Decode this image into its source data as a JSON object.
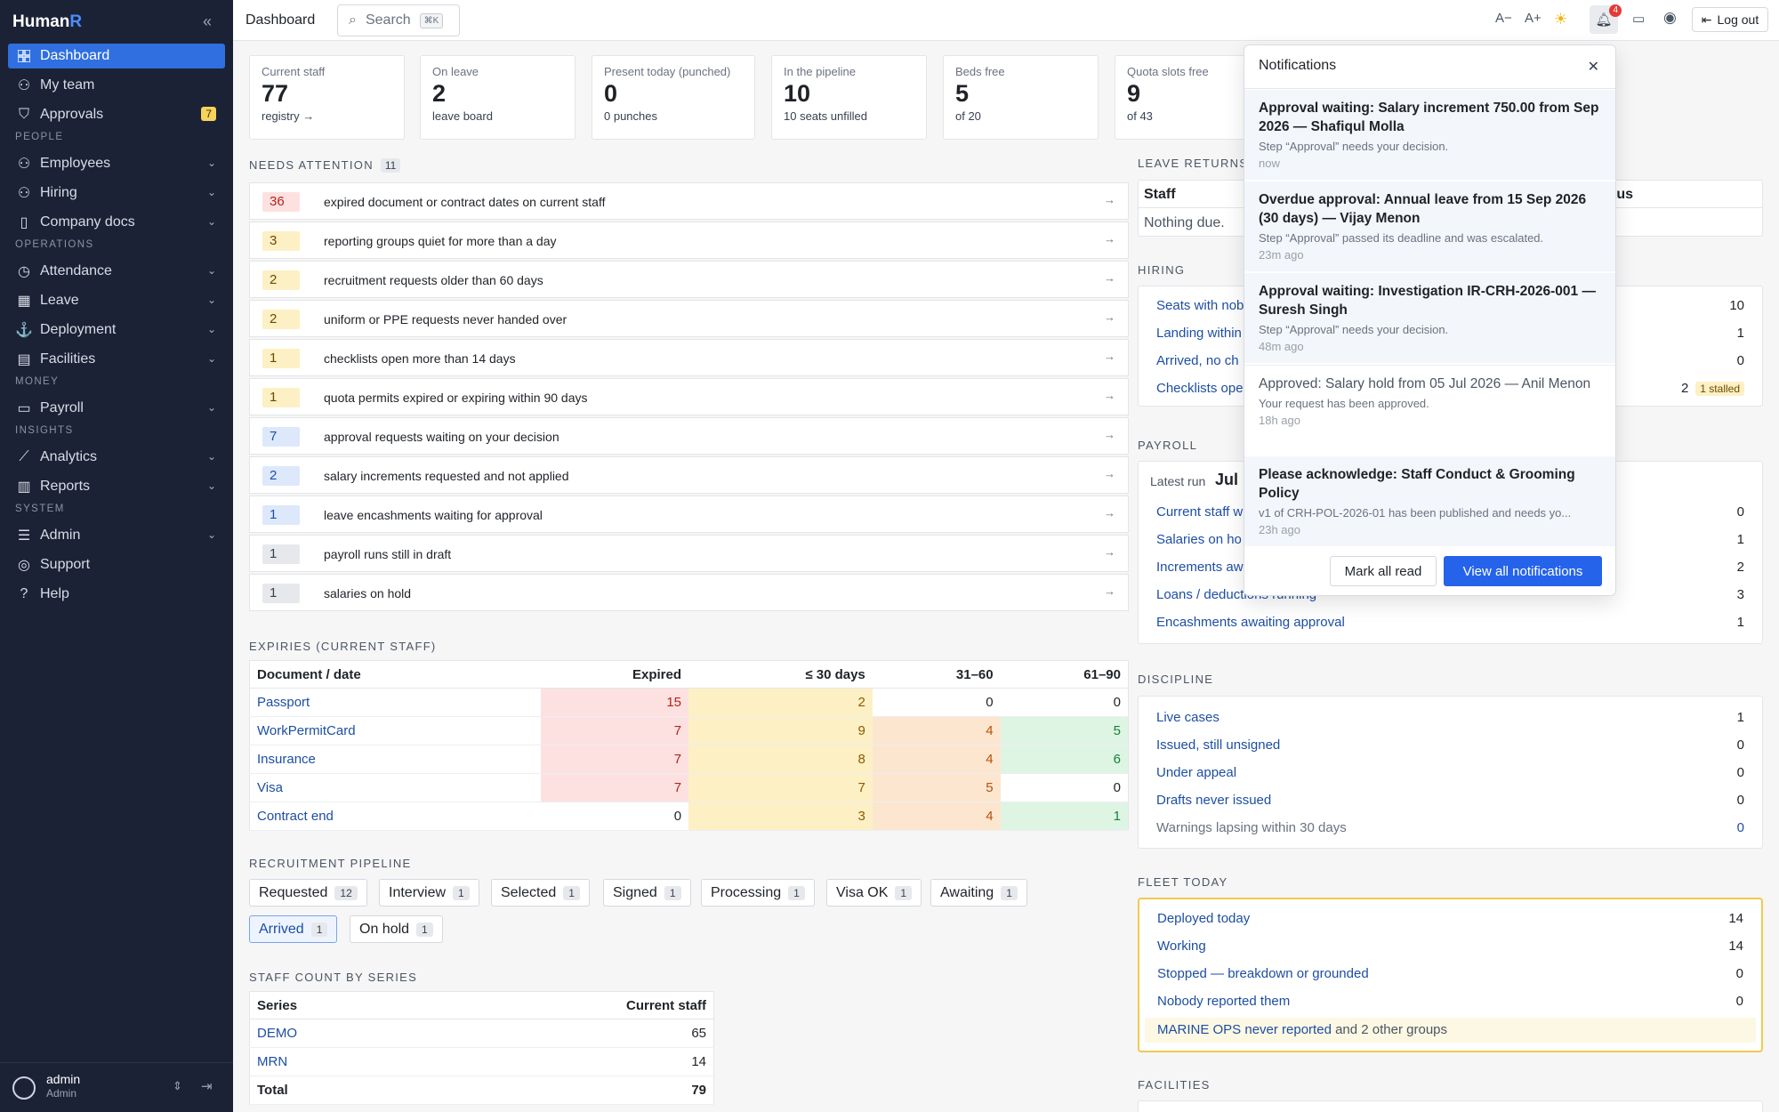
{
  "app": {
    "brand_main": "Human",
    "brand_accent": "R",
    "page_title": "Dashboard"
  },
  "search": {
    "label": "Search",
    "shortcut": "⌘K"
  },
  "topbar": {
    "font_smaller": "A−",
    "font_larger": "A+",
    "notification_count": "4",
    "logout": "Log out"
  },
  "sidebar": {
    "items": [
      {
        "label": "Dashboard"
      },
      {
        "label": "My team"
      },
      {
        "label": "Approvals",
        "badge": "7"
      },
      {
        "label": "Employees"
      },
      {
        "label": "Hiring"
      },
      {
        "label": "Company docs"
      },
      {
        "label": "Attendance"
      },
      {
        "label": "Leave"
      },
      {
        "label": "Deployment"
      },
      {
        "label": "Facilities"
      },
      {
        "label": "Payroll"
      },
      {
        "label": "Analytics"
      },
      {
        "label": "Reports"
      },
      {
        "label": "Admin"
      },
      {
        "label": "Support"
      },
      {
        "label": "Help"
      }
    ],
    "sections": [
      "PEOPLE",
      "OPERATIONS",
      "MONEY",
      "INSIGHTS",
      "SYSTEM"
    ],
    "user": {
      "name": "admin",
      "role": "Admin"
    }
  },
  "stats": [
    {
      "label": "Current staff",
      "value": "77",
      "sub": "registry →"
    },
    {
      "label": "On leave",
      "value": "2",
      "sub": "leave board"
    },
    {
      "label": "Present today (punched)",
      "value": "0",
      "sub": "0 punches"
    },
    {
      "label": "In the pipeline",
      "value": "10",
      "sub": "10 seats unfilled"
    },
    {
      "label": "Beds free",
      "value": "5",
      "sub": "of 20"
    },
    {
      "label": "Quota slots free",
      "value": "9",
      "sub": "of 43"
    }
  ],
  "attention": {
    "title": "NEEDS ATTENTION",
    "count": "11",
    "items": [
      {
        "n": "36",
        "text": "expired document or contract dates on current staff"
      },
      {
        "n": "3",
        "text": "reporting groups quiet for more than a day"
      },
      {
        "n": "2",
        "text": "recruitment requests older than 60 days"
      },
      {
        "n": "2",
        "text": "uniform or PPE requests never handed over"
      },
      {
        "n": "1",
        "text": "checklists open more than 14 days"
      },
      {
        "n": "1",
        "text": "quota permits expired or expiring within 90 days"
      },
      {
        "n": "7",
        "text": "approval requests waiting on your decision"
      },
      {
        "n": "2",
        "text": "salary increments requested and not applied"
      },
      {
        "n": "1",
        "text": "leave encashments waiting for approval"
      },
      {
        "n": "1",
        "text": "payroll runs still in draft"
      },
      {
        "n": "1",
        "text": "salaries on hold"
      }
    ]
  },
  "expiries": {
    "title": "EXPIRIES (CURRENT STAFF)",
    "headers": [
      "Document / date",
      "Expired",
      "≤ 30 days",
      "31–60",
      "61–90"
    ],
    "rows": [
      {
        "doc": "Passport",
        "vals": [
          "15",
          "2",
          "0",
          "0"
        ]
      },
      {
        "doc": "WorkPermitCard",
        "vals": [
          "7",
          "9",
          "4",
          "5"
        ]
      },
      {
        "doc": "Insurance",
        "vals": [
          "7",
          "8",
          "4",
          "6"
        ]
      },
      {
        "doc": "Visa",
        "vals": [
          "7",
          "7",
          "5",
          "0"
        ]
      },
      {
        "doc": "Contract end",
        "vals": [
          "0",
          "3",
          "4",
          "1"
        ]
      }
    ]
  },
  "pipeline": {
    "title": "RECRUITMENT PIPELINE",
    "stages": [
      {
        "label": "Requested",
        "count": "12"
      },
      {
        "label": "Interview",
        "count": "1"
      },
      {
        "label": "Selected",
        "count": "1"
      },
      {
        "label": "Signed",
        "count": "1"
      },
      {
        "label": "Processing",
        "count": "1"
      },
      {
        "label": "Visa OK",
        "count": "1"
      },
      {
        "label": "Awaiting",
        "count": "1"
      },
      {
        "label": "Arrived",
        "count": "1"
      },
      {
        "label": "On hold",
        "count": "1"
      }
    ]
  },
  "series": {
    "title": "STAFF COUNT BY SERIES",
    "headers": [
      "Series",
      "Current staff"
    ],
    "rows": [
      {
        "name": "DEMO",
        "count": "65"
      },
      {
        "name": "MRN",
        "count": "14"
      }
    ],
    "total_label": "Total",
    "total": "79"
  },
  "leave_returns": {
    "title": "LEAVE RETURNS",
    "col_staff": "Staff",
    "col_status_partial": "tus",
    "empty": "Nothing due."
  },
  "hiring": {
    "title": "HIRING",
    "rows": [
      {
        "label": "Seats with nob",
        "value": "10"
      },
      {
        "label": "Landing within",
        "value": "1"
      },
      {
        "label": "Arrived, no ch",
        "value": "0"
      },
      {
        "label": "Checklists ope",
        "value": "2",
        "tag": "1 stalled"
      }
    ]
  },
  "payroll": {
    "title": "PAYROLL",
    "latest_label": "Latest run",
    "latest_value": "Jul",
    "rows": [
      {
        "label": "Current staff w",
        "value": "0"
      },
      {
        "label": "Salaries on ho",
        "value": "1"
      },
      {
        "label": "Increments aw",
        "value": "2"
      },
      {
        "label": "Loans / deductions running",
        "value": "3"
      },
      {
        "label": "Encashments awaiting approval",
        "value": "1"
      }
    ]
  },
  "discipline": {
    "title": "DISCIPLINE",
    "rows": [
      {
        "label": "Live cases",
        "value": "1"
      },
      {
        "label": "Issued, still unsigned",
        "value": "0"
      },
      {
        "label": "Under appeal",
        "value": "0"
      },
      {
        "label": "Drafts never issued",
        "value": "0"
      },
      {
        "label": "Warnings lapsing within 30 days",
        "value": "0"
      }
    ]
  },
  "fleet": {
    "title": "FLEET TODAY",
    "rows": [
      {
        "label": "Deployed today",
        "value": "14"
      },
      {
        "label": "Working",
        "value": "14"
      },
      {
        "label": "Stopped — breakdown or grounded",
        "value": "0"
      },
      {
        "label": "Nobody reported them",
        "value": "0"
      }
    ],
    "note_link": "MARINE OPS never reported",
    "note_rest": "and 2 other groups"
  },
  "facilities": {
    "title": "FACILITIES"
  },
  "notifications": {
    "title": "Notifications",
    "items": [
      {
        "title": "Approval waiting: Salary increment 750.00 from Sep 2026 — Shafiqul Molla",
        "desc": "Step “Approval” needs your decision.",
        "time": "now"
      },
      {
        "title": "Overdue approval: Annual leave from 15 Sep 2026 (30 days) — Vijay Menon",
        "desc": "Step “Approval” passed its deadline and was escalated.",
        "time": "23m ago"
      },
      {
        "title": "Approval waiting: Investigation IR-CRH-2026-001 — Suresh Singh",
        "desc": "Step “Approval” needs your decision.",
        "time": "48m ago"
      },
      {
        "title": "Approved: Salary hold from 05 Jul 2026 — Anil Menon",
        "desc": "Your request has been approved.",
        "time": "18h ago"
      },
      {
        "title": "Please acknowledge: Staff Conduct & Grooming Policy",
        "desc": "v1 of CRH-POL-2026-01 has been published and needs yo...",
        "time": "23h ago"
      }
    ],
    "mark_all": "Mark all read",
    "view_all": "View all notifications"
  },
  "colors": {
    "sidebar_bg": "#1b2236",
    "accent": "#2563eb",
    "danger": "#b42318"
  }
}
